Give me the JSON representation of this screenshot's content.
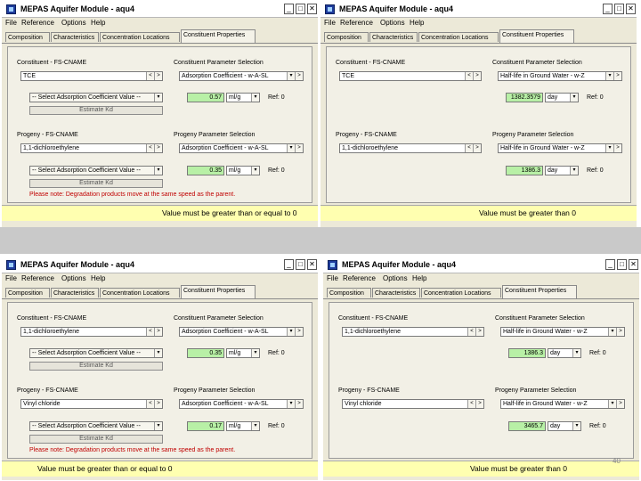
{
  "windows": [
    {
      "title": "MEPAS Aquifer Module - aqu4",
      "menu": [
        "File",
        "Reference",
        "Options",
        "Help"
      ],
      "tabs": [
        "Composition",
        "Characteristics",
        "Concentration Locations",
        "Constituent Properties"
      ],
      "constituent_label": "Constituent - FS-CNAME",
      "constituent_value": "TCE",
      "param_label": "Constituent Parameter Selection",
      "param_value": "Adsorption Coefficient - w-A-SL",
      "select_text": "-- Select Adsorption Coefficient Value --",
      "value": "0.57",
      "unit": "ml/g",
      "ref": "Ref: 0",
      "estimate_label": "Estimate Kd",
      "progeny_label": "Progeny - FS-CNAME",
      "progeny_value": "1,1-dichloroethylene",
      "progeny_param_label": "Progeny Parameter Selection",
      "progeny_param_value": "Adsorption Coefficient - w-A-SL",
      "progeny_select_text": "-- Select Adsorption Coefficient Value --",
      "progeny_value_num": "0.35",
      "progeny_unit": "ml/g",
      "progeny_ref": "Ref: 0",
      "progeny_estimate": "Estimate Kd",
      "note": "Please note: Degradation products move at the same speed as the parent.",
      "status": "Value must be greater than or equal to 0"
    },
    {
      "title": "MEPAS Aquifer Module - aqu4",
      "menu": [
        "File",
        "Reference",
        "Options",
        "Help"
      ],
      "tabs": [
        "Composition",
        "Characteristics",
        "Concentration Locations",
        "Constituent Properties"
      ],
      "constituent_label": "Constituent - FS-CNAME",
      "constituent_value": "TCE",
      "param_label": "Constituent Parameter Selection",
      "param_value": "Half-life in Ground Water - w-Z",
      "value": "1382.3579",
      "unit": "day",
      "ref": "Ref: 0",
      "progeny_label": "Progeny - FS-CNAME",
      "progeny_value": "1,1-dichloroethylene",
      "progeny_param_label": "Progeny Parameter Selection",
      "progeny_param_value": "Half-life in Ground Water - w-Z",
      "progeny_value_num": "1386.3",
      "progeny_unit": "day",
      "progeny_ref": "Ref: 0",
      "status": "Value must be greater than 0"
    },
    {
      "title": "MEPAS Aquifer Module - aqu4",
      "menu": [
        "File",
        "Reference",
        "Options",
        "Help"
      ],
      "tabs": [
        "Composition",
        "Characteristics",
        "Concentration Locations",
        "Constituent Properties"
      ],
      "constituent_label": "Constituent - FS-CNAME",
      "constituent_value": "1,1-dichloroethylene",
      "param_label": "Constituent Parameter Selection",
      "param_value": "Adsorption Coefficient - w-A-SL",
      "select_text": "-- Select Adsorption Coefficient Value --",
      "value": "0.35",
      "unit": "ml/g",
      "ref": "Ref: 0",
      "estimate_label": "Estimate Kd",
      "progeny_label": "Progeny - FS-CNAME",
      "progeny_value": "Vinyl chloride",
      "progeny_param_label": "Progeny Parameter Selection",
      "progeny_param_value": "Adsorption Coefficient - w-A-SL",
      "progeny_select_text": "-- Select Adsorption Coefficient Value --",
      "progeny_value_num": "0.17",
      "progeny_unit": "ml/g",
      "progeny_ref": "Ref: 0",
      "progeny_estimate": "Estimate Kd",
      "note": "Please note: Degradation products move at the same speed as the parent.",
      "status": "Value must be greater than or equal to 0"
    },
    {
      "title": "MEPAS Aquifer Module - aqu4",
      "menu": [
        "File",
        "Reference",
        "Options",
        "Help"
      ],
      "tabs": [
        "Composition",
        "Characteristics",
        "Concentration Locations",
        "Constituent Properties"
      ],
      "constituent_label": "Constituent - FS-CNAME",
      "constituent_value": "1,1-dichloroethylene",
      "param_label": "Constituent Parameter Selection",
      "param_value": "Half-life in Ground Water - w-Z",
      "value": "1386.3",
      "unit": "day",
      "ref": "Ref: 0",
      "progeny_label": "Progeny - FS-CNAME",
      "progeny_value": "Vinyl chloride",
      "progeny_param_label": "Progeny Parameter Selection",
      "progeny_param_value": "Half-life in Ground Water - w-Z",
      "progeny_value_num": "3465.7",
      "progeny_unit": "day",
      "progeny_ref": "Ref: 0",
      "status": "Value must be greater than 0"
    }
  ],
  "page_number": "40"
}
